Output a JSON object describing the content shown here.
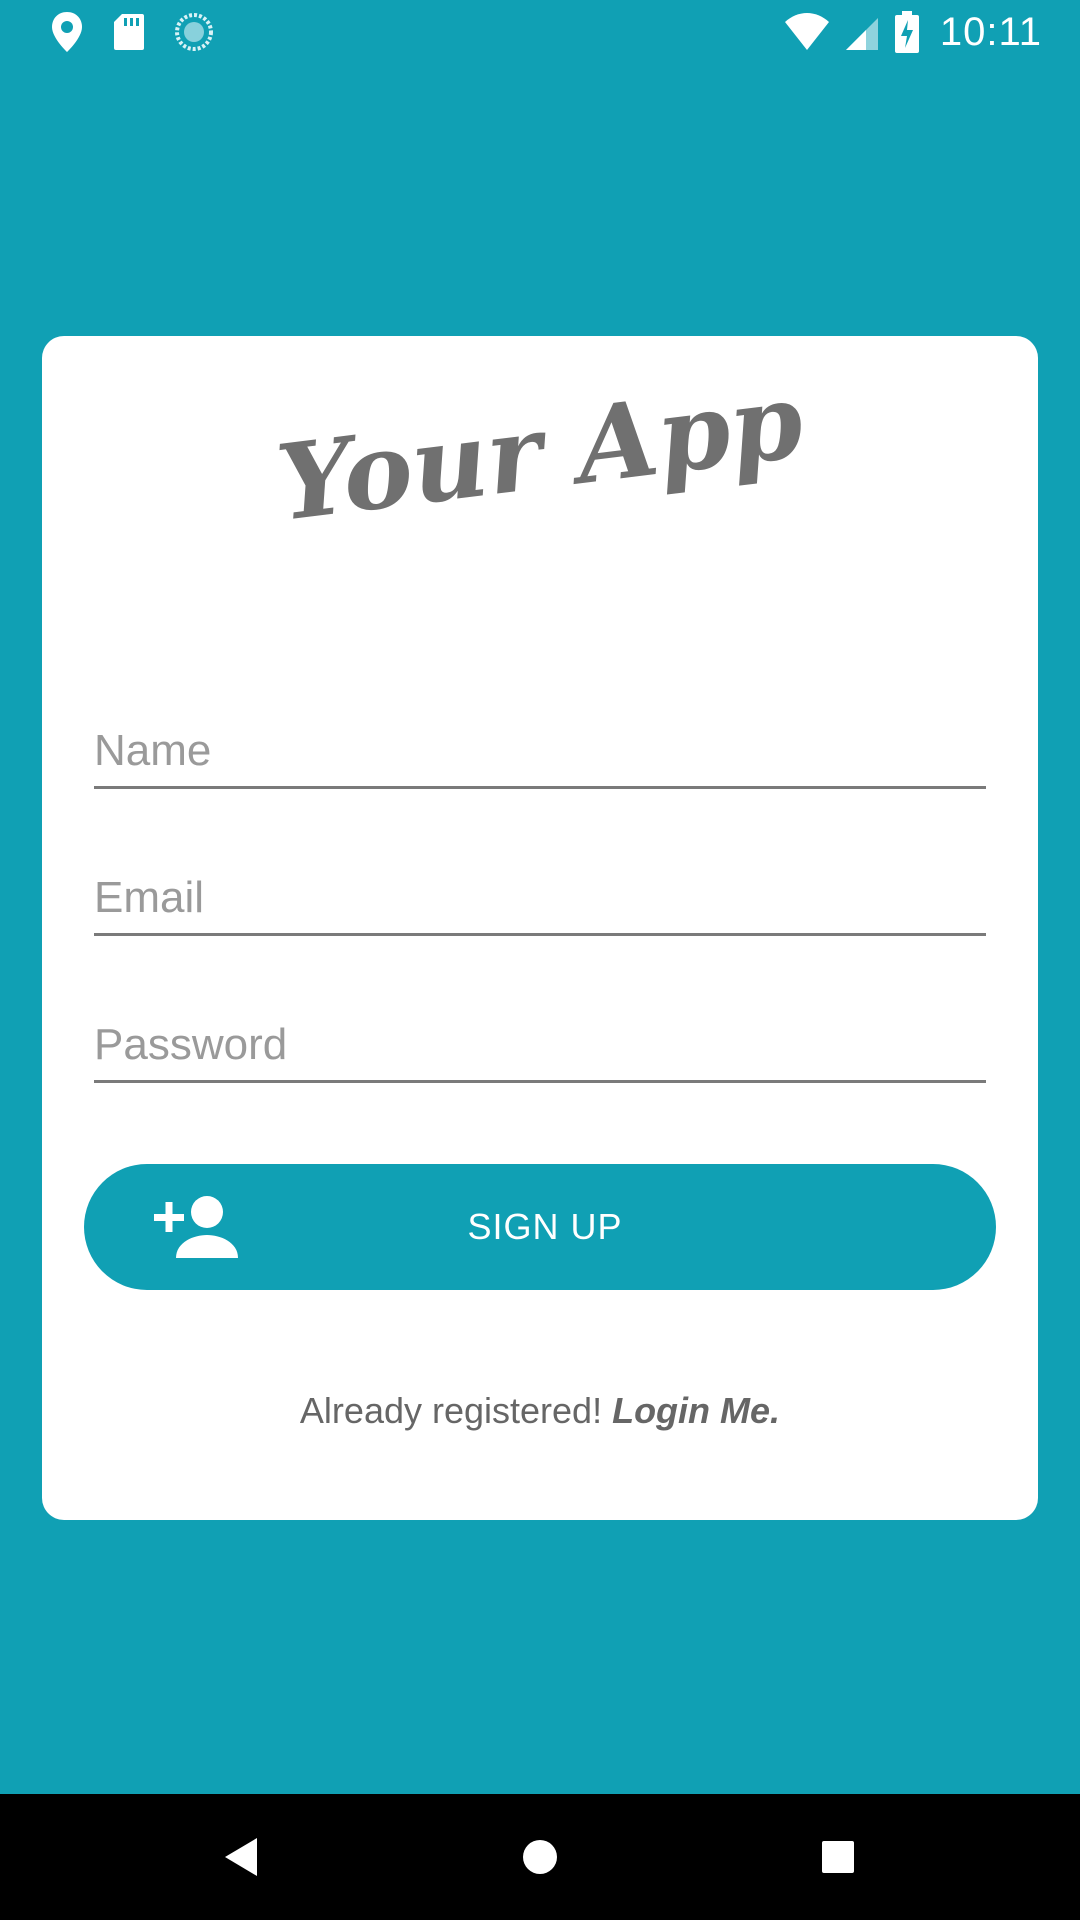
{
  "status_bar": {
    "time": "10:11",
    "left_icons": [
      "location-icon",
      "sd-card-icon",
      "sync-icon"
    ],
    "right_icons": [
      "wifi-icon",
      "signal-icon",
      "battery-charging-icon"
    ]
  },
  "app": {
    "title": "Your App"
  },
  "form": {
    "name_placeholder": "Name",
    "email_placeholder": "Email",
    "password_placeholder": "Password",
    "signup_label": "SIGN UP",
    "signup_icon": "add-person-icon"
  },
  "footer": {
    "already_text": "Already registered! ",
    "login_link": "Login Me."
  },
  "nav": {
    "back": "back-icon",
    "home": "home-icon",
    "recents": "recents-icon"
  },
  "colors": {
    "primary": "#10A0B4",
    "card": "#FFFFFF",
    "text_gray": "#707070"
  }
}
